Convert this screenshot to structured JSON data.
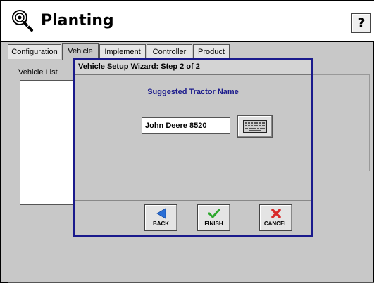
{
  "header": {
    "app_icon": "planting-seed-icon",
    "title": "Planting",
    "help_label": "?"
  },
  "tabs": [
    {
      "label": "Configuration",
      "active": false
    },
    {
      "label": "Vehicle",
      "active": true
    },
    {
      "label": "Implement",
      "active": false
    },
    {
      "label": "Controller",
      "active": false
    },
    {
      "label": "Product",
      "active": false
    }
  ],
  "vehicle_panel": {
    "list_label": "Vehicle List"
  },
  "wizard": {
    "title": "Vehicle Setup Wizard:  Step 2 of 2",
    "subtitle": "Suggested Tractor Name",
    "name_value": "John Deere 8520",
    "keyboard_icon": "keyboard-icon",
    "buttons": {
      "back": {
        "label": "BACK",
        "icon": "arrow-left-icon"
      },
      "finish": {
        "label": "FINISH",
        "icon": "checkmark-icon"
      },
      "cancel": {
        "label": "CANCEL",
        "icon": "x-mark-icon"
      }
    }
  },
  "colors": {
    "dialog_border": "#1a1a8c",
    "subtitle": "#1a1a8c",
    "back_arrow": "#2a6fd6",
    "finish_check": "#2fa82f",
    "cancel_x": "#d82a2a",
    "panel_bg": "#c8c8c8"
  }
}
